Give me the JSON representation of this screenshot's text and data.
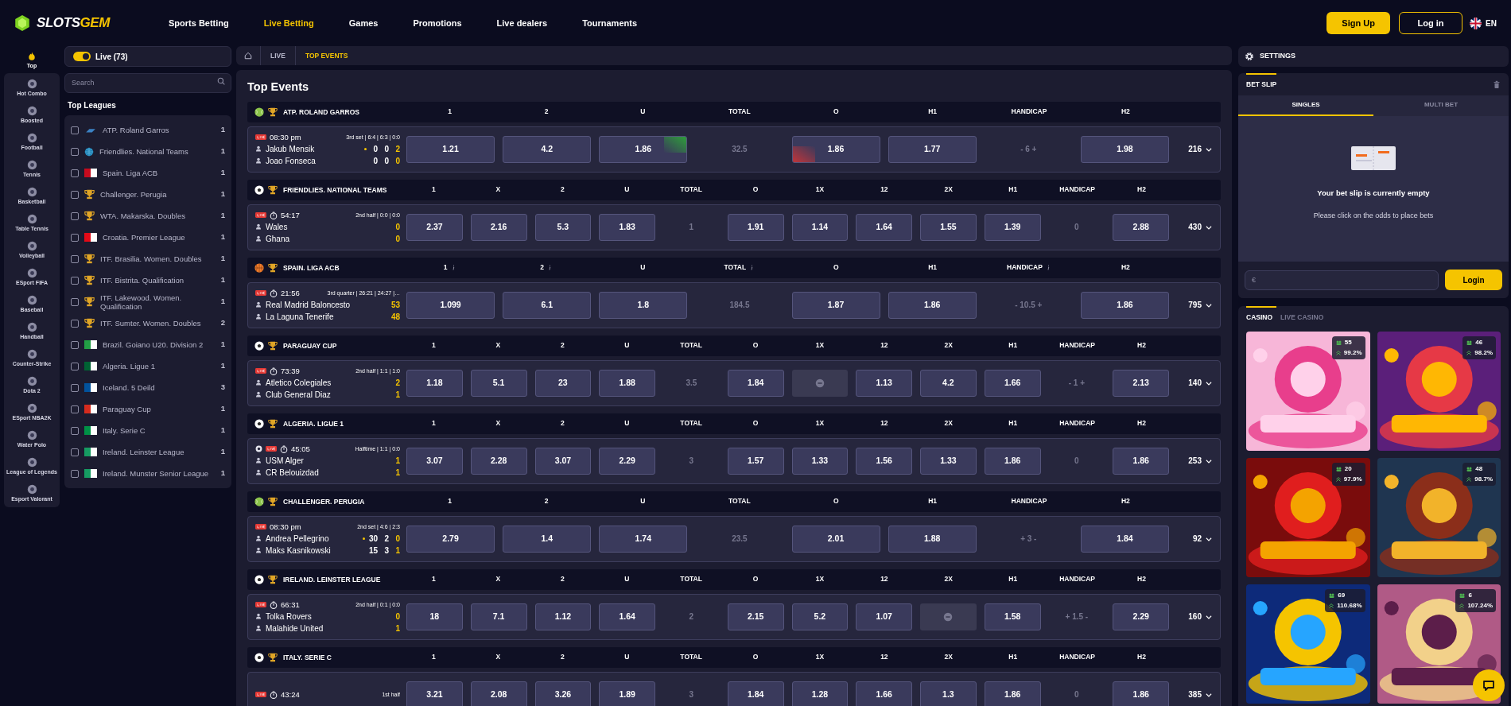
{
  "header": {
    "logo_parts": [
      "SLOTS",
      "GEM"
    ],
    "nav": [
      {
        "label": "Sports Betting",
        "selected": false
      },
      {
        "label": "Live Betting",
        "selected": true
      },
      {
        "label": "Games",
        "selected": false
      },
      {
        "label": "Promotions",
        "selected": false
      },
      {
        "label": "Live dealers",
        "selected": false
      },
      {
        "label": "Tournaments",
        "selected": false
      }
    ],
    "sign_up": "Sign Up",
    "log_in": "Log in",
    "language": "EN"
  },
  "sports": [
    {
      "label": "Top",
      "selected": true
    },
    {
      "label": "Hot Combo",
      "selected": false
    },
    {
      "label": "Boosted",
      "selected": false
    },
    {
      "label": "Football",
      "selected": false
    },
    {
      "label": "Tennis",
      "selected": false
    },
    {
      "label": "Basketball",
      "selected": false
    },
    {
      "label": "Table Tennis",
      "selected": false
    },
    {
      "label": "Volleyball",
      "selected": false
    },
    {
      "label": "ESport FIFA",
      "selected": false
    },
    {
      "label": "Baseball",
      "selected": false
    },
    {
      "label": "Handball",
      "selected": false
    },
    {
      "label": "Counter-Strike",
      "selected": false
    },
    {
      "label": "Dota 2",
      "selected": false
    },
    {
      "label": "ESport NBA2K",
      "selected": false
    },
    {
      "label": "Water Polo",
      "selected": false
    },
    {
      "label": "League of Legends",
      "selected": false
    },
    {
      "label": "Esport Valorant",
      "selected": false
    }
  ],
  "leagues_panel": {
    "live_toggle": {
      "label": "Live (73)",
      "on": true
    },
    "search": {
      "placeholder": "Search"
    },
    "title": "Top Leagues",
    "leagues": [
      {
        "name": "ATP. Roland Garros",
        "count": "1",
        "checked": false,
        "kind": "logo"
      },
      {
        "name": "Friendlies. National Teams",
        "count": "1",
        "checked": false,
        "kind": "globe"
      },
      {
        "name": "Spain. Liga ACB",
        "count": "1",
        "checked": false,
        "kind": "flag",
        "color": "#c60b1e"
      },
      {
        "name": "Challenger. Perugia",
        "count": "1",
        "checked": false,
        "kind": "trophy"
      },
      {
        "name": "WTA. Makarska. Doubles",
        "count": "1",
        "checked": false,
        "kind": "trophy"
      },
      {
        "name": "Croatia. Premier League",
        "count": "1",
        "checked": false,
        "kind": "flag",
        "color": "#e30a17"
      },
      {
        "name": "ITF. Brasilia. Women. Doubles",
        "count": "1",
        "checked": false,
        "kind": "trophy"
      },
      {
        "name": "ITF. Bistrita. Qualification",
        "count": "1",
        "checked": false,
        "kind": "trophy"
      },
      {
        "name": "ITF. Lakewood. Women. Qualification",
        "count": "1",
        "checked": false,
        "kind": "trophy"
      },
      {
        "name": "ITF. Sumter. Women. Doubles",
        "count": "2",
        "checked": false,
        "kind": "trophy"
      },
      {
        "name": "Brazil. Goiano U20. Division 2",
        "count": "1",
        "checked": false,
        "kind": "flag",
        "color": "#229e45"
      },
      {
        "name": "Algeria. Ligue 1",
        "count": "1",
        "checked": false,
        "kind": "flag",
        "color": "#006233"
      },
      {
        "name": "Iceland. 5 Deild",
        "count": "3",
        "checked": false,
        "kind": "flag",
        "color": "#02529c"
      },
      {
        "name": "Paraguay Cup",
        "count": "1",
        "checked": false,
        "kind": "flag",
        "color": "#d52b1e"
      },
      {
        "name": "Italy. Serie C",
        "count": "1",
        "checked": false,
        "kind": "flag",
        "color": "#009246"
      },
      {
        "name": "Ireland. Leinster League",
        "count": "1",
        "checked": false,
        "kind": "flag",
        "color": "#169b62"
      },
      {
        "name": "Ireland. Munster Senior League",
        "count": "1",
        "checked": false,
        "kind": "flag",
        "color": "#169b62"
      }
    ]
  },
  "breadcrumb": [
    {
      "label": "LIVE",
      "selected": false
    },
    {
      "label": "TOP EVENTS",
      "selected": true
    }
  ],
  "main_title": "Top Events",
  "events": [
    {
      "league": "ATP. ROLAND GARROS",
      "kind": "tennis",
      "columns": [
        {
          "label": "1",
          "info": false
        },
        {
          "label": "2",
          "info": false
        },
        {
          "label": "U",
          "info": false
        },
        {
          "label": "TOTAL",
          "info": false
        },
        {
          "label": "O",
          "info": false
        },
        {
          "label": "H1",
          "info": false
        },
        {
          "label": "HANDICAP",
          "info": false
        },
        {
          "label": "H2",
          "info": false
        }
      ],
      "match": {
        "stream": false,
        "live": true,
        "timer": false,
        "time": "08:30 pm",
        "period": "3rd set | 6:4 | 6:3 | 0:0",
        "teams": [
          {
            "name": "Jakub Mensik",
            "serving": true,
            "scores": [
              "0",
              "0",
              "2"
            ]
          },
          {
            "name": "Joao Fonseca",
            "serving": false,
            "scores": [
              "0",
              "0",
              "0"
            ]
          }
        ],
        "cells": [
          {
            "kind": "odd",
            "text": "1.21"
          },
          {
            "kind": "odd",
            "text": "4.2"
          },
          {
            "kind": "odd_up",
            "text": "1.86"
          },
          {
            "kind": "line",
            "text": "32.5"
          },
          {
            "kind": "odd_down",
            "text": "1.86"
          },
          {
            "kind": "odd",
            "text": "1.77"
          },
          {
            "kind": "line",
            "text": "- 6 +"
          },
          {
            "kind": "odd",
            "text": "1.98"
          }
        ],
        "more": "216"
      }
    },
    {
      "league": "FRIENDLIES. NATIONAL TEAMS",
      "kind": "football",
      "columns": [
        {
          "label": "1",
          "info": false
        },
        {
          "label": "X",
          "info": false
        },
        {
          "label": "2",
          "info": false
        },
        {
          "label": "U",
          "info": false
        },
        {
          "label": "TOTAL",
          "info": false
        },
        {
          "label": "O",
          "info": false
        },
        {
          "label": "1X",
          "info": false
        },
        {
          "label": "12",
          "info": false
        },
        {
          "label": "2X",
          "info": false
        },
        {
          "label": "H1",
          "info": false
        },
        {
          "label": "HANDICAP",
          "info": false
        },
        {
          "label": "H2",
          "info": false
        }
      ],
      "match": {
        "stream": false,
        "live": true,
        "timer": true,
        "time": "54:17",
        "period": "2nd half | 0:0 | 0:0",
        "teams": [
          {
            "name": "Wales",
            "serving": false,
            "scores": [
              "0"
            ]
          },
          {
            "name": "Ghana",
            "serving": false,
            "scores": [
              "0"
            ]
          }
        ],
        "cells": [
          {
            "kind": "odd",
            "text": "2.37"
          },
          {
            "kind": "odd",
            "text": "2.16"
          },
          {
            "kind": "odd",
            "text": "5.3"
          },
          {
            "kind": "odd",
            "text": "1.83"
          },
          {
            "kind": "line",
            "text": "1"
          },
          {
            "kind": "odd",
            "text": "1.91"
          },
          {
            "kind": "odd",
            "text": "1.14"
          },
          {
            "kind": "odd",
            "text": "1.64"
          },
          {
            "kind": "odd",
            "text": "1.55"
          },
          {
            "kind": "odd",
            "text": "1.39"
          },
          {
            "kind": "line",
            "text": "0"
          },
          {
            "kind": "odd",
            "text": "2.88"
          }
        ],
        "more": "430"
      }
    },
    {
      "league": "SPAIN. LIGA ACB",
      "kind": "basketball",
      "columns": [
        {
          "label": "1",
          "info": true
        },
        {
          "label": "2",
          "info": true
        },
        {
          "label": "U",
          "info": false
        },
        {
          "label": "TOTAL",
          "info": true
        },
        {
          "label": "O",
          "info": false
        },
        {
          "label": "H1",
          "info": false
        },
        {
          "label": "HANDICAP",
          "info": true
        },
        {
          "label": "H2",
          "info": false
        }
      ],
      "match": {
        "stream": false,
        "live": true,
        "timer": true,
        "time": "21:56",
        "period": "3rd quarter | 26:21 | 24:27 |…",
        "teams": [
          {
            "name": "Real Madrid Baloncesto",
            "serving": false,
            "scores": [
              "53"
            ]
          },
          {
            "name": "La Laguna Tenerife",
            "serving": false,
            "scores": [
              "48"
            ]
          }
        ],
        "cells": [
          {
            "kind": "odd",
            "text": "1.099"
          },
          {
            "kind": "odd",
            "text": "6.1"
          },
          {
            "kind": "odd",
            "text": "1.8"
          },
          {
            "kind": "line",
            "text": "184.5"
          },
          {
            "kind": "odd",
            "text": "1.87"
          },
          {
            "kind": "odd",
            "text": "1.86"
          },
          {
            "kind": "line",
            "text": "- 10.5 +"
          },
          {
            "kind": "odd",
            "text": "1.86"
          }
        ],
        "more": "795"
      }
    },
    {
      "league": "PARAGUAY CUP",
      "kind": "football",
      "columns": [
        {
          "label": "1",
          "info": false
        },
        {
          "label": "X",
          "info": false
        },
        {
          "label": "2",
          "info": false
        },
        {
          "label": "U",
          "info": false
        },
        {
          "label": "TOTAL",
          "info": false
        },
        {
          "label": "O",
          "info": false
        },
        {
          "label": "1X",
          "info": false
        },
        {
          "label": "12",
          "info": false
        },
        {
          "label": "2X",
          "info": false
        },
        {
          "label": "H1",
          "info": false
        },
        {
          "label": "HANDICAP",
          "info": false
        },
        {
          "label": "H2",
          "info": false
        }
      ],
      "match": {
        "stream": false,
        "live": true,
        "timer": true,
        "time": "73:39",
        "period": "2nd half | 1:1 | 1:0",
        "teams": [
          {
            "name": "Atletico Colegiales",
            "serving": false,
            "scores": [
              "2"
            ]
          },
          {
            "name": "Club General Diaz",
            "serving": false,
            "scores": [
              "1"
            ]
          }
        ],
        "cells": [
          {
            "kind": "odd",
            "text": "1.18"
          },
          {
            "kind": "odd",
            "text": "5.1"
          },
          {
            "kind": "odd",
            "text": "23"
          },
          {
            "kind": "odd",
            "text": "1.88"
          },
          {
            "kind": "line",
            "text": "3.5"
          },
          {
            "kind": "odd",
            "text": "1.84"
          },
          {
            "kind": "locked"
          },
          {
            "kind": "odd",
            "text": "1.13"
          },
          {
            "kind": "odd",
            "text": "4.2"
          },
          {
            "kind": "odd",
            "text": "1.66"
          },
          {
            "kind": "line",
            "text": "- 1 +"
          },
          {
            "kind": "odd",
            "text": "2.13"
          }
        ],
        "more": "140"
      }
    },
    {
      "league": "ALGERIA. LIGUE 1",
      "kind": "football",
      "columns": [
        {
          "label": "1",
          "info": false
        },
        {
          "label": "X",
          "info": false
        },
        {
          "label": "2",
          "info": false
        },
        {
          "label": "U",
          "info": false
        },
        {
          "label": "TOTAL",
          "info": false
        },
        {
          "label": "O",
          "info": false
        },
        {
          "label": "1X",
          "info": false
        },
        {
          "label": "12",
          "info": false
        },
        {
          "label": "2X",
          "info": false
        },
        {
          "label": "H1",
          "info": false
        },
        {
          "label": "HANDICAP",
          "info": false
        },
        {
          "label": "H2",
          "info": false
        }
      ],
      "match": {
        "stream": true,
        "live": true,
        "timer": true,
        "time": "45:05",
        "period": "Halftime | 1:1 | 0:0",
        "teams": [
          {
            "name": "USM Alger",
            "serving": false,
            "scores": [
              "1"
            ]
          },
          {
            "name": "CR Belouizdad",
            "serving": false,
            "scores": [
              "1"
            ]
          }
        ],
        "cells": [
          {
            "kind": "odd",
            "text": "3.07"
          },
          {
            "kind": "odd",
            "text": "2.28"
          },
          {
            "kind": "odd",
            "text": "3.07"
          },
          {
            "kind": "odd",
            "text": "2.29"
          },
          {
            "kind": "line",
            "text": "3"
          },
          {
            "kind": "odd",
            "text": "1.57"
          },
          {
            "kind": "odd",
            "text": "1.33"
          },
          {
            "kind": "odd",
            "text": "1.56"
          },
          {
            "kind": "odd",
            "text": "1.33"
          },
          {
            "kind": "odd",
            "text": "1.86"
          },
          {
            "kind": "line",
            "text": "0"
          },
          {
            "kind": "odd",
            "text": "1.86"
          }
        ],
        "more": "253"
      }
    },
    {
      "league": "CHALLENGER. PERUGIA",
      "kind": "tennis",
      "columns": [
        {
          "label": "1",
          "info": false
        },
        {
          "label": "2",
          "info": false
        },
        {
          "label": "U",
          "info": false
        },
        {
          "label": "TOTAL",
          "info": false
        },
        {
          "label": "O",
          "info": false
        },
        {
          "label": "H1",
          "info": false
        },
        {
          "label": "HANDICAP",
          "info": false
        },
        {
          "label": "H2",
          "info": false
        }
      ],
      "match": {
        "stream": false,
        "live": true,
        "timer": false,
        "time": "08:30 pm",
        "period": "2nd set | 4:6 | 2:3",
        "teams": [
          {
            "name": "Andrea Pellegrino",
            "serving": true,
            "scores": [
              "30",
              "2",
              "0"
            ]
          },
          {
            "name": "Maks Kasnikowski",
            "serving": false,
            "scores": [
              "15",
              "3",
              "1"
            ]
          }
        ],
        "cells": [
          {
            "kind": "odd",
            "text": "2.79"
          },
          {
            "kind": "odd",
            "text": "1.4"
          },
          {
            "kind": "odd",
            "text": "1.74"
          },
          {
            "kind": "line",
            "text": "23.5"
          },
          {
            "kind": "odd",
            "text": "2.01"
          },
          {
            "kind": "odd",
            "text": "1.88"
          },
          {
            "kind": "line",
            "text": "+ 3 -"
          },
          {
            "kind": "odd",
            "text": "1.84"
          }
        ],
        "more": "92"
      }
    },
    {
      "league": "IRELAND. LEINSTER LEAGUE",
      "kind": "football",
      "columns": [
        {
          "label": "1",
          "info": false
        },
        {
          "label": "X",
          "info": false
        },
        {
          "label": "2",
          "info": false
        },
        {
          "label": "U",
          "info": false
        },
        {
          "label": "TOTAL",
          "info": false
        },
        {
          "label": "O",
          "info": false
        },
        {
          "label": "1X",
          "info": false
        },
        {
          "label": "12",
          "info": false
        },
        {
          "label": "2X",
          "info": false
        },
        {
          "label": "H1",
          "info": false
        },
        {
          "label": "HANDICAP",
          "info": false
        },
        {
          "label": "H2",
          "info": false
        }
      ],
      "match": {
        "stream": false,
        "live": true,
        "timer": true,
        "time": "66:31",
        "period": "2nd half | 0:1 | 0:0",
        "teams": [
          {
            "name": "Tolka Rovers",
            "serving": false,
            "scores": [
              "0"
            ]
          },
          {
            "name": "Malahide United",
            "serving": false,
            "scores": [
              "1"
            ]
          }
        ],
        "cells": [
          {
            "kind": "odd",
            "text": "18"
          },
          {
            "kind": "odd",
            "text": "7.1"
          },
          {
            "kind": "odd",
            "text": "1.12"
          },
          {
            "kind": "odd",
            "text": "1.64"
          },
          {
            "kind": "line",
            "text": "2"
          },
          {
            "kind": "odd",
            "text": "2.15"
          },
          {
            "kind": "odd",
            "text": "5.2"
          },
          {
            "kind": "odd",
            "text": "1.07"
          },
          {
            "kind": "locked"
          },
          {
            "kind": "odd",
            "text": "1.58"
          },
          {
            "kind": "line",
            "text": "+ 1.5 -"
          },
          {
            "kind": "odd",
            "text": "2.29"
          }
        ],
        "more": "160"
      }
    },
    {
      "league": "ITALY. SERIE C",
      "kind": "football",
      "columns": [
        {
          "label": "1",
          "info": false
        },
        {
          "label": "X",
          "info": false
        },
        {
          "label": "2",
          "info": false
        },
        {
          "label": "U",
          "info": false
        },
        {
          "label": "TOTAL",
          "info": false
        },
        {
          "label": "O",
          "info": false
        },
        {
          "label": "1X",
          "info": false
        },
        {
          "label": "12",
          "info": false
        },
        {
          "label": "2X",
          "info": false
        },
        {
          "label": "H1",
          "info": false
        },
        {
          "label": "HANDICAP",
          "info": false
        },
        {
          "label": "H2",
          "info": false
        }
      ],
      "match": {
        "stream": false,
        "live": true,
        "timer": true,
        "time": "43:24",
        "period": "1st half",
        "cells": [
          {
            "kind": "odd",
            "text": "3.21"
          },
          {
            "kind": "odd",
            "text": "2.08"
          },
          {
            "kind": "odd",
            "text": "3.26"
          },
          {
            "kind": "odd",
            "text": "1.89"
          },
          {
            "kind": "line",
            "text": "3"
          },
          {
            "kind": "odd",
            "text": "1.84"
          },
          {
            "kind": "odd",
            "text": "1.28"
          },
          {
            "kind": "odd",
            "text": "1.66"
          },
          {
            "kind": "odd",
            "text": "1.3"
          },
          {
            "kind": "odd",
            "text": "1.86"
          },
          {
            "kind": "line",
            "text": "0"
          },
          {
            "kind": "odd",
            "text": "1.86"
          }
        ],
        "more": "385"
      }
    }
  ],
  "right_panel": {
    "settings": "SETTINGS",
    "bet_slip": {
      "title": "BET SLIP",
      "tabs": [
        {
          "label": "SINGLES",
          "selected": true
        },
        {
          "label": "MULTI BET",
          "selected": false
        }
      ],
      "empty_title": "Your bet slip is currently empty",
      "empty_hint": "Please click on the odds to place bets",
      "stake": {
        "placeholder": "€"
      },
      "login": "Login"
    },
    "casino": {
      "tabs": [
        {
          "label": "CASINO",
          "selected": true
        },
        {
          "label": "LIVE CASINO",
          "selected": false
        }
      ],
      "games": [
        {
          "kind": "picture",
          "players": "55",
          "rtp": "99.2%"
        },
        {
          "kind": "picture",
          "players": "46",
          "rtp": "98.2%"
        },
        {
          "kind": "picture",
          "players": "20",
          "rtp": "97.9%"
        },
        {
          "kind": "picture",
          "players": "48",
          "rtp": "98.7%"
        },
        {
          "kind": "picture",
          "players": "69",
          "rtp": "110.68%"
        },
        {
          "kind": "picture",
          "players": "6",
          "rtp": "107.24%"
        }
      ]
    }
  }
}
